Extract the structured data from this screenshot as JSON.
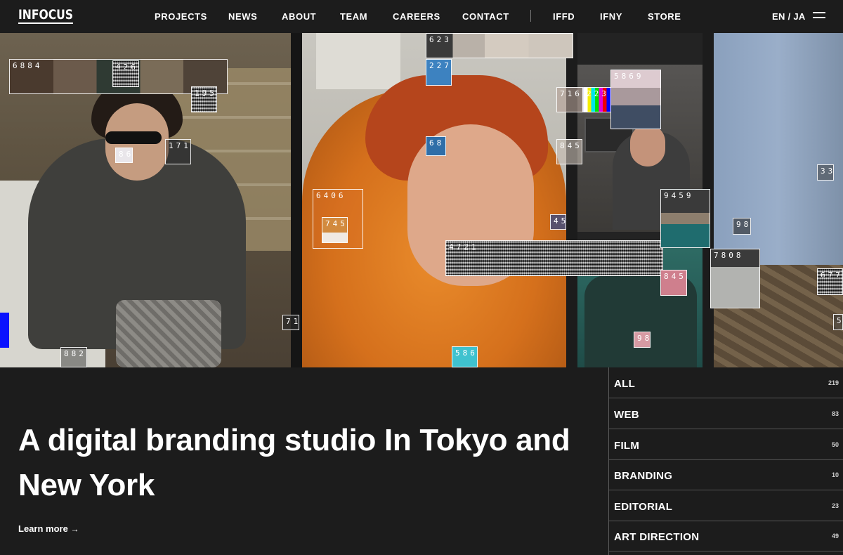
{
  "header": {
    "logo": "INFOCUS",
    "nav": [
      {
        "label": "PROJECTS"
      },
      {
        "label": "NEWS"
      },
      {
        "label": "ABOUT"
      },
      {
        "label": "TEAM"
      },
      {
        "label": "CAREERS"
      },
      {
        "label": "CONTACT"
      },
      {
        "label": "IFFD"
      },
      {
        "label": "IFNY"
      },
      {
        "label": "STORE"
      }
    ],
    "lang": "EN / JA",
    "menu_icon": "hamburger-menu-icon"
  },
  "hero": {
    "glitch_labels": [
      "6884",
      "426",
      "195",
      "86",
      "171",
      "71",
      "882",
      "623",
      "227",
      "68",
      "6406",
      "745",
      "586",
      "4721",
      "716",
      "223",
      "5869",
      "845",
      "45",
      "9459",
      "7808",
      "845",
      "98",
      "33",
      "98",
      "677",
      "5"
    ]
  },
  "intro": {
    "headline": "A digital branding studio In Tokyo and New York",
    "learn_more": "Learn more",
    "arrow_icon": "arrow-right-icon"
  },
  "categories": [
    {
      "label": "ALL",
      "count": "219"
    },
    {
      "label": "WEB",
      "count": "83"
    },
    {
      "label": "FILM",
      "count": "50"
    },
    {
      "label": "BRANDING",
      "count": "10"
    },
    {
      "label": "EDITORIAL",
      "count": "23"
    },
    {
      "label": "ART DIRECTION",
      "count": "49"
    }
  ],
  "colors": {
    "background": "#1c1c1c",
    "text": "#ffffff",
    "divider": "#555555",
    "accent_orange": "#d5701c"
  }
}
